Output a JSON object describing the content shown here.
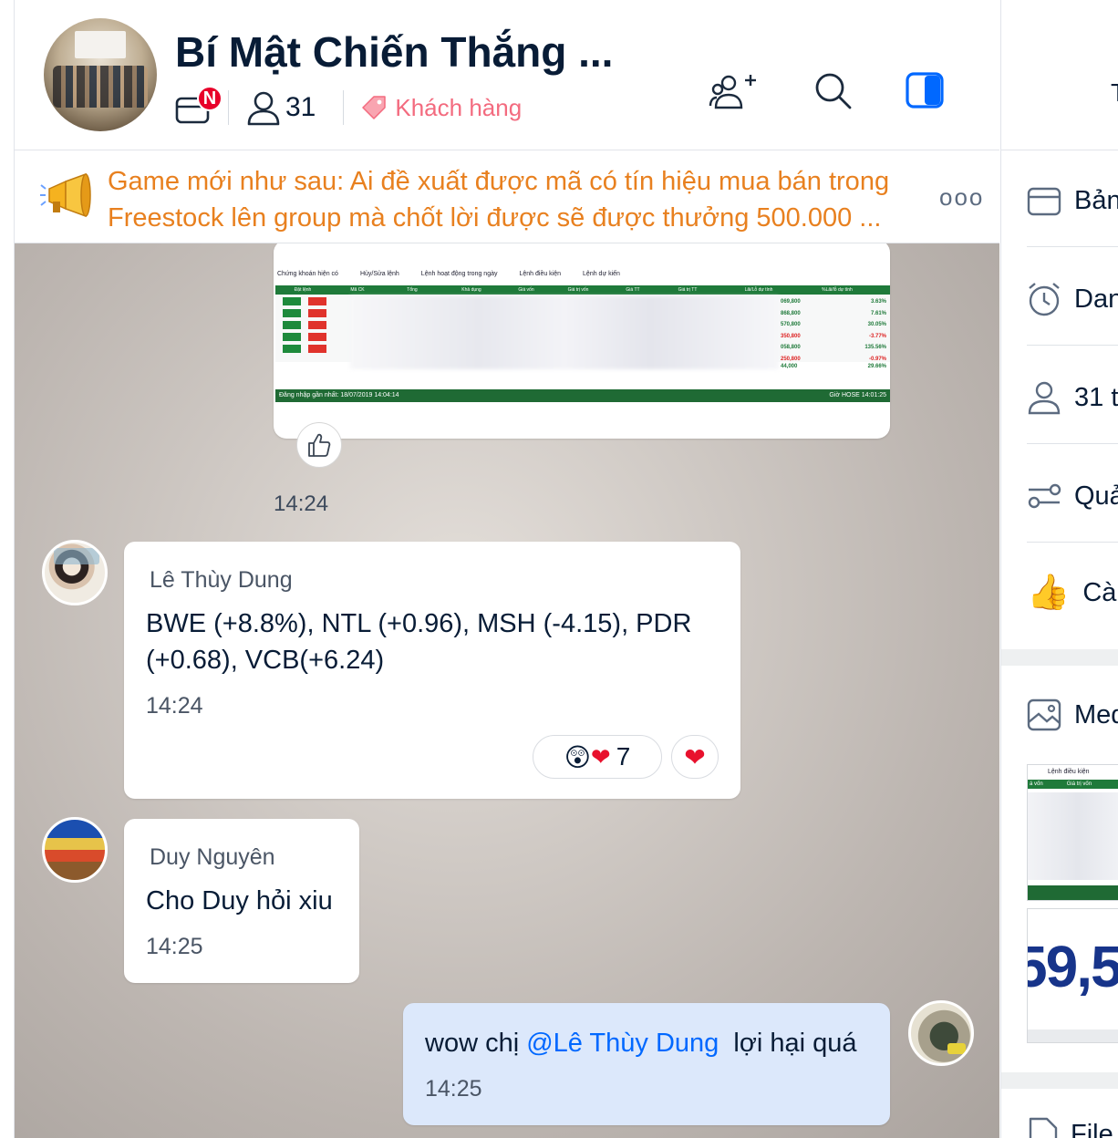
{
  "header": {
    "title": "Bí Mật Chiến Thắng ...",
    "notification_badge": "N",
    "member_count": "31",
    "tag_label": "Khách hàng"
  },
  "pinned": {
    "text": "Game mới như sau: Ai đề xuất được mã có tín hiệu mua bán trong Freestock lên group mà chốt lời được sẽ được thưởng 500.000 ...",
    "more": "ooo"
  },
  "image_message": {
    "tabs": [
      "Chứng khoán hiện có",
      "Hủy/Sửa lệnh",
      "Lệnh hoạt động trong ngày",
      "Lệnh điều kiện",
      "Lệnh dự kiến"
    ],
    "columns": [
      "Đặt lệnh",
      "Mã CK",
      "Tổng",
      "Khả dụng",
      "Giá vốn",
      "Giá trị vốn",
      "Giá TT",
      "Giá trị TT",
      "Lãi/Lỗ dự tính",
      "%Lãi/lỗ dự tính"
    ],
    "buy_label": "MUA",
    "sell_label": "BÁN",
    "pnl_values": [
      "069,800",
      "868,800",
      "570,800",
      "350,800",
      "058,800",
      "250,800"
    ],
    "pct_values": [
      "3.63%",
      "7.61%",
      "30.05%",
      "-3.77%",
      "135.56%",
      "-0.97%"
    ],
    "last_row": [
      "44,000",
      "29.66%"
    ],
    "footer_left": "Đăng nhập gần nhất: 18/07/2019 14:04:14",
    "footer_right": "Giờ HOSE 14:01:25",
    "time": "14:24"
  },
  "messages": [
    {
      "sender": "Lê Thùy Dung",
      "text": "BWE (+8.8%), NTL (+0.96), MSH (-4.15), PDR (+0.68), VCB(+6.24)",
      "time": "14:24",
      "reaction_count": "7"
    },
    {
      "sender": "Duy Nguyên",
      "text": "Cho Duy hỏi xiu",
      "time": "14:25"
    },
    {
      "prefix": "wow chị ",
      "mention": "@Lê Thùy Dung",
      "suffix": "  lợi hại quá",
      "time": "14:25"
    }
  ],
  "right_panel": {
    "header_char": "T",
    "items": [
      {
        "label": "Bản",
        "icon": "board-icon"
      },
      {
        "label": "Dan",
        "icon": "alarm-clock-icon"
      },
      {
        "label": "31 t",
        "icon": "person-icon"
      },
      {
        "label": "Quả",
        "icon": "sliders-icon"
      },
      {
        "label": "Cài",
        "icon": "thumbs-up-icon"
      },
      {
        "label": "Med",
        "icon": "image-icon"
      },
      {
        "label": "File",
        "icon": "file-icon"
      }
    ],
    "media_thumb_text": "Lệnh điều kiện",
    "media_thumb_cols": [
      "á vốn",
      "Giá trị vốn"
    ],
    "media_big_number": "59,5"
  },
  "colors": {
    "accent_blue": "#0068ff",
    "pinned_orange": "#e8801f",
    "tag_pink": "#f36b7f",
    "badge_red": "#e8002a",
    "table_green": "#1f7a3a"
  }
}
